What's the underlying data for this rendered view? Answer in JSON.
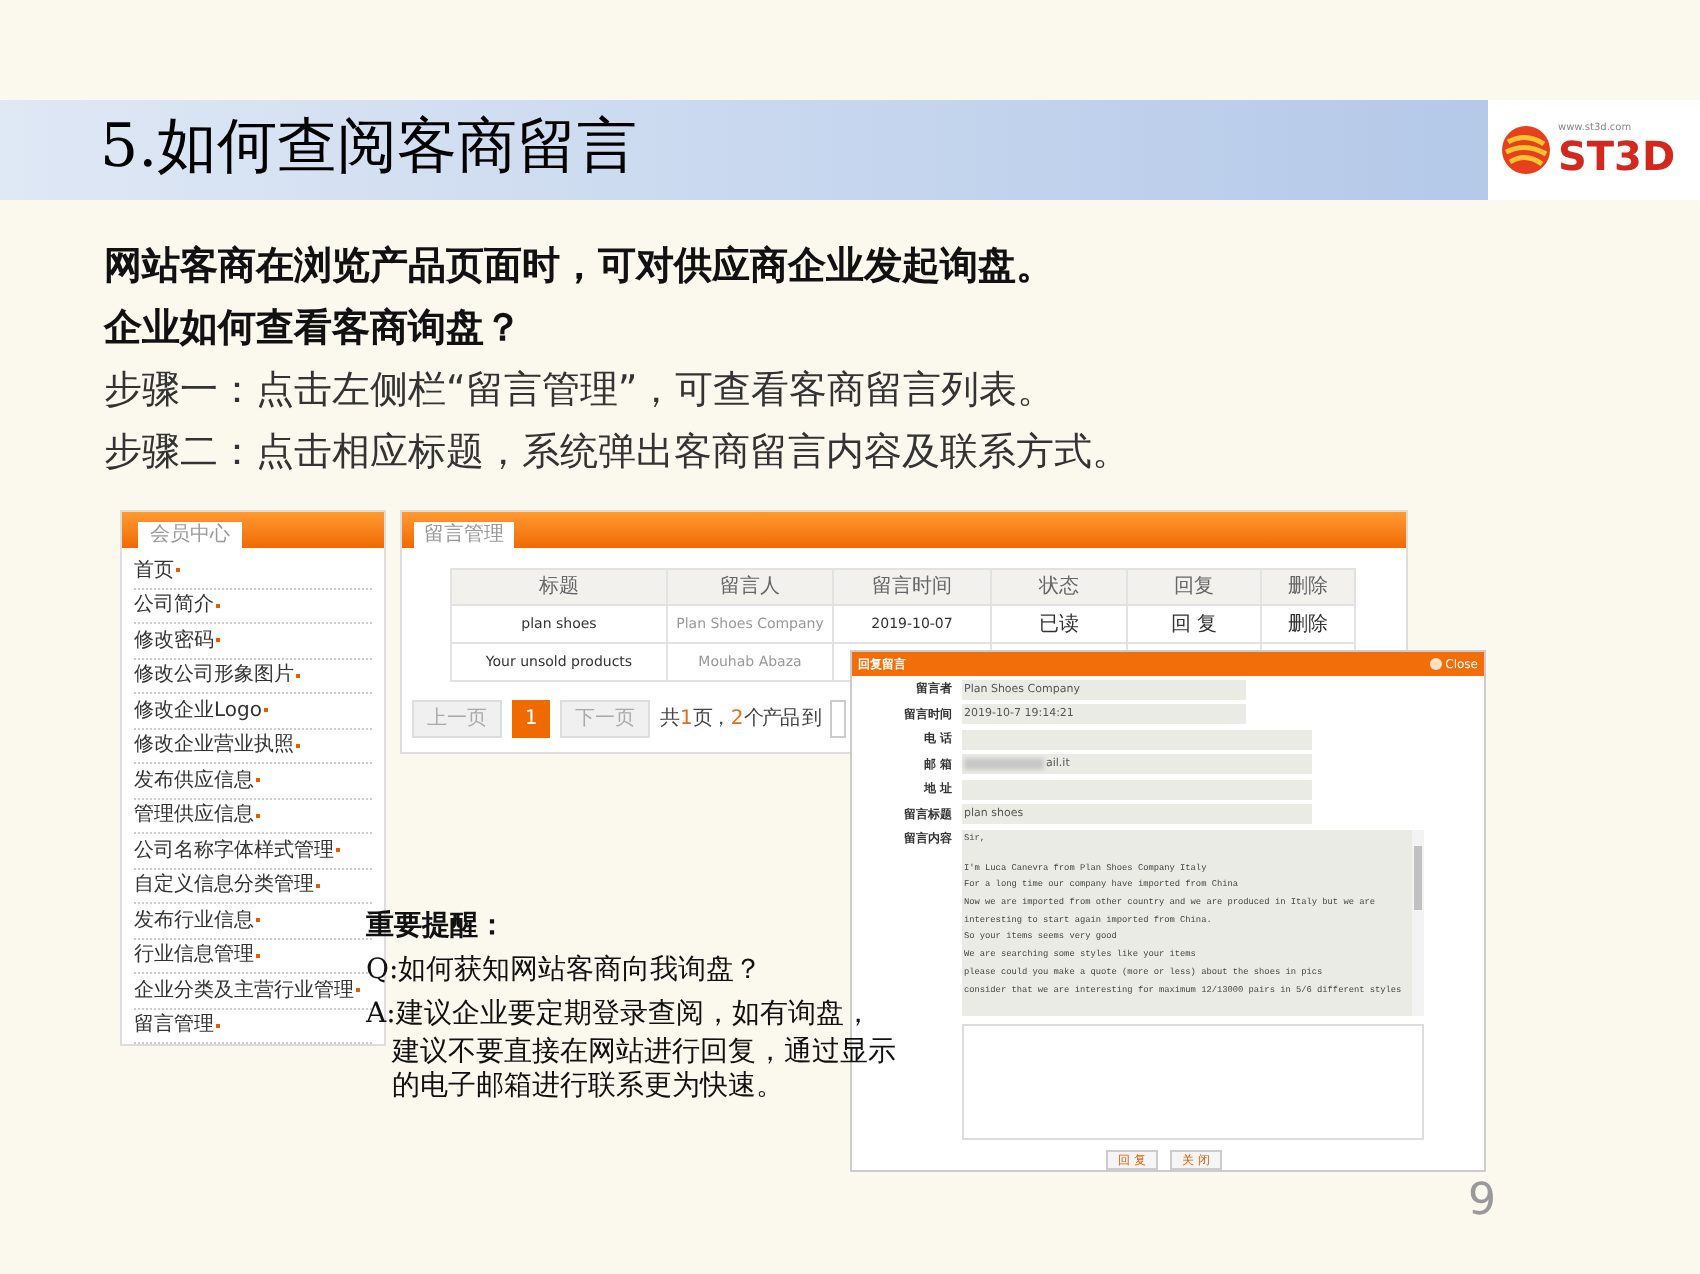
{
  "header": {
    "title": "5.如何查阅客商留言",
    "logo": {
      "text": "ST3D",
      "url": "www.st3d.com"
    }
  },
  "intro": [
    {
      "text": "网站客商在浏览产品页面时，可对供应商企业发起询盘。",
      "bold": true
    },
    {
      "text": "企业如何查看客商询盘？",
      "bold": true
    },
    {
      "text": "步骤一：点击左侧栏“留言管理”，可查看客商留言列表。",
      "bold": false
    },
    {
      "text": "步骤二：点击相应标题，系统弹出客商留言内容及联系方式。",
      "bold": false
    }
  ],
  "sidebar": {
    "tab": "会员中心",
    "items": [
      "首页",
      "公司简介",
      "修改密码",
      "修改公司形象图片",
      "修改企业Logo",
      "修改企业营业执照",
      "发布供应信息",
      "管理供应信息",
      "公司名称字体样式管理",
      "自定义信息分类管理",
      "发布行业信息",
      "行业信息管理",
      "企业分类及主营行业管理",
      "留言管理"
    ]
  },
  "messages": {
    "tab": "留言管理",
    "columns": [
      "标题",
      "留言人",
      "留言时间",
      "状态",
      "回复",
      "删除"
    ],
    "rows": [
      [
        "plan shoes",
        "Plan Shoes Company",
        "2019-10-07",
        "已读",
        "回 复",
        "删除"
      ],
      [
        "Your unsold products",
        "Mouhab Abaza"
      ]
    ],
    "pagination": {
      "prev": "上一页",
      "pages": [
        {
          "label": "1",
          "selected": true
        }
      ],
      "next": "下一页",
      "summary": [
        {
          "text": "共",
          "highlight": false
        },
        {
          "text": "1",
          "highlight": true
        },
        {
          "text": "页，",
          "highlight": false
        },
        {
          "text": "2",
          "highlight": true
        },
        {
          "text": "个产品 到",
          "highlight": false
        }
      ]
    }
  },
  "dialog": {
    "title": "回复留言",
    "close": "Close",
    "fields": [
      {
        "label": "留言者",
        "value": "Plan Shoes Company"
      },
      {
        "label": "留言时间",
        "value": "2019-10-7 19:14:21"
      },
      {
        "label": "电 话"
      },
      {
        "label": "邮 箱",
        "value": "ail.it"
      },
      {
        "label": "地 址"
      },
      {
        "label": "留言标题",
        "value": "plan shoes"
      }
    ],
    "content_label": "留言内容",
    "content_lines": [
      "Sir,",
      "I'm Luca Canevra from Plan Shoes Company Italy",
      "For a long time our company have imported from China",
      "Now we are imported from other country and we are produced in Italy but we are",
      "interesting to start again imported from China.",
      "So your items seems very good",
      "We are searching some styles like your items",
      "please could you make a quote (more or less) about the shoes in pics",
      "consider that we are interesting for maximum 12/13000 pairs in 5/6 different styles"
    ],
    "buttons": [
      "回 复",
      "关 闭"
    ]
  },
  "note": {
    "title": "重要提醒：",
    "lines": [
      "Q:如何获知网站客商向我询盘？",
      "A:建议企业要定期登录查阅，如有询盘，",
      "建议不要直接在网站进行回复，通过显示",
      "的电子邮箱进行联系更为快速。"
    ]
  },
  "page_number": "9"
}
